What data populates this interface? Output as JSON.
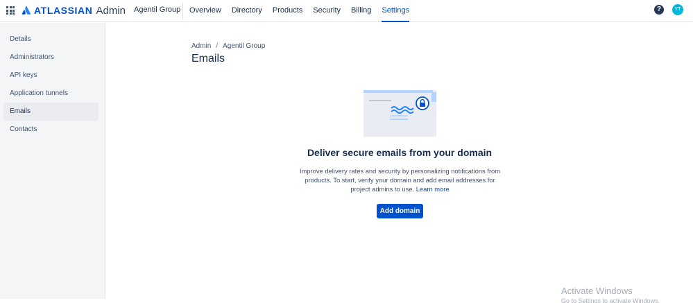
{
  "header": {
    "logo_word": "ATLASSIAN",
    "logo_suffix": "Admin",
    "org_name": "Agentil Group",
    "tabs": [
      {
        "label": "Overview",
        "active": false
      },
      {
        "label": "Directory",
        "active": false
      },
      {
        "label": "Products",
        "active": false
      },
      {
        "label": "Security",
        "active": false
      },
      {
        "label": "Billing",
        "active": false
      },
      {
        "label": "Settings",
        "active": true
      }
    ],
    "help_icon": "question-circle-icon",
    "help_glyph": "?",
    "avatar_initials": "YT"
  },
  "sidebar": {
    "items": [
      {
        "label": "Details",
        "active": false
      },
      {
        "label": "Administrators",
        "active": false
      },
      {
        "label": "API keys",
        "active": false
      },
      {
        "label": "Application tunnels",
        "active": false
      },
      {
        "label": "Emails",
        "active": true
      },
      {
        "label": "Contacts",
        "active": false
      }
    ]
  },
  "main": {
    "breadcrumb": [
      "Admin",
      "Agentil Group"
    ],
    "breadcrumb_separator": "/",
    "title": "Emails",
    "illustration": "envelope-lock-icon",
    "heading": "Deliver secure emails from your domain",
    "description": "Improve delivery rates and security by personalizing notifications from products. To start, verify your domain and add email addresses for project admins to use.",
    "learn_more": "Learn more",
    "primary_button": "Add domain"
  },
  "watermark": {
    "title": "Activate Windows",
    "subtitle": "Go to Settings to activate Windows."
  },
  "colors": {
    "brand": "#0052cc",
    "text": "#172b4d",
    "subtle_text": "#42526e",
    "sidebar_bg": "#f4f5f7"
  }
}
